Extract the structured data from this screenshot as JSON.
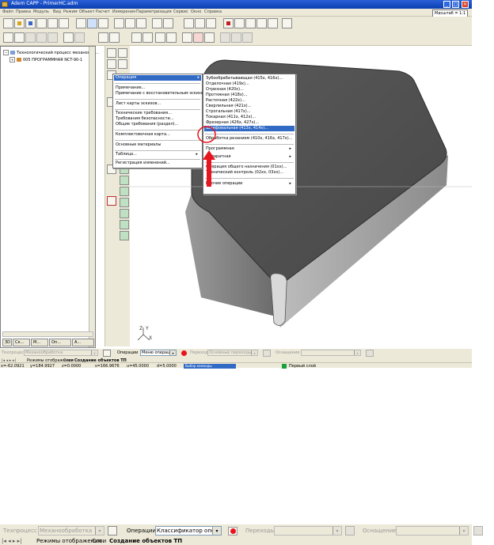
{
  "window": {
    "title": "Adem CAPP - PrimerHC.adm",
    "zoom_label": "Масштаб = 1:1",
    "buttons": [
      "minimize",
      "maximize",
      "close"
    ]
  },
  "menubar": {
    "items": [
      "Файл",
      "Правка",
      "Модуль",
      "Вид",
      "Режим",
      "Объект",
      "Расчет",
      "Измерения",
      "Параметризация",
      "Сервис",
      "Окно",
      "Справка"
    ]
  },
  "tree": {
    "root": "Технологический процесс механообр...",
    "child": "005  ПРОГРАММНАЯ NCT-90-1"
  },
  "bottom_tabs": [
    "3D",
    "Ск...",
    "М...",
    "Оп...",
    "А..."
  ],
  "context_menu": {
    "items": [
      {
        "label": "Операция",
        "highlighted": true,
        "submenu": true
      },
      {
        "label": "Примечание..."
      },
      {
        "label": "Примечание с восстановительным эскизом..."
      },
      {
        "label": "Лист карты эскизов..."
      },
      {
        "label": "Технические требования..."
      },
      {
        "label": "Требования безопасности..."
      },
      {
        "label": "Общие требования (раздел)..."
      },
      {
        "label": "Комплектовочная карта..."
      },
      {
        "label": "Основные материалы"
      },
      {
        "label": "Таблица...",
        "submenu": true
      },
      {
        "label": "Регистрация изменений..."
      }
    ]
  },
  "submenu": {
    "items": [
      {
        "label": "Зубообрабатывающая (415х, 416х)..."
      },
      {
        "label": "Отделочная (419х)..."
      },
      {
        "label": "Отрезная (420х)..."
      },
      {
        "label": "Протяжная (418х)..."
      },
      {
        "label": "Расточная (422х)..."
      },
      {
        "label": "Сверлильная (421х)..."
      },
      {
        "label": "Строгальная (417х)..."
      },
      {
        "label": "Токарная (411х, 412х)..."
      },
      {
        "label": "Фрезерная (426х, 427х)..."
      },
      {
        "label": "Шлифовальная (413х, 414х)...",
        "highlighted": true
      },
      {
        "label": "Обработка резанием (410х, 416х, 417х)..."
      },
      {
        "label": "Программная",
        "submenu": true
      },
      {
        "label": "Аппаратная",
        "submenu": true
      },
      {
        "label": "Операция общего назначения (01хх)..."
      },
      {
        "label": "Технический контроль (02хх, 03хх)..."
      },
      {
        "label": "Прочие операции",
        "submenu": true
      }
    ]
  },
  "axis_labels": {
    "z": "Z",
    "y": "Y",
    "x": "X"
  },
  "status": {
    "techprocess_label": "Техпроцесс",
    "techprocess_value": "Механообработка",
    "operations_label": "Операции",
    "operations_value_small": "Меню операций",
    "operations_value_big": "Классификатор операц",
    "transitions_label": "Переходы",
    "transitions_value": "Основные переходы",
    "equipment_label": "Оснащение",
    "tabs": [
      "Режимы отображения",
      "Слои",
      "Создание объектов ТП"
    ],
    "coords": {
      "x": "x=-62.0921",
      "y": "y=184.9927",
      "z": "z=0.0000",
      "s": "s=166.9676",
      "u": "u=45.0000",
      "d": "d=5.0000"
    },
    "command": "Выбор команды",
    "layer": "Первый слой"
  },
  "colors": {
    "titlebar": "#0a3fb0",
    "highlight": "#316ac5",
    "red_arrow": "#e8141e",
    "layer_green": "#1aa03a"
  }
}
